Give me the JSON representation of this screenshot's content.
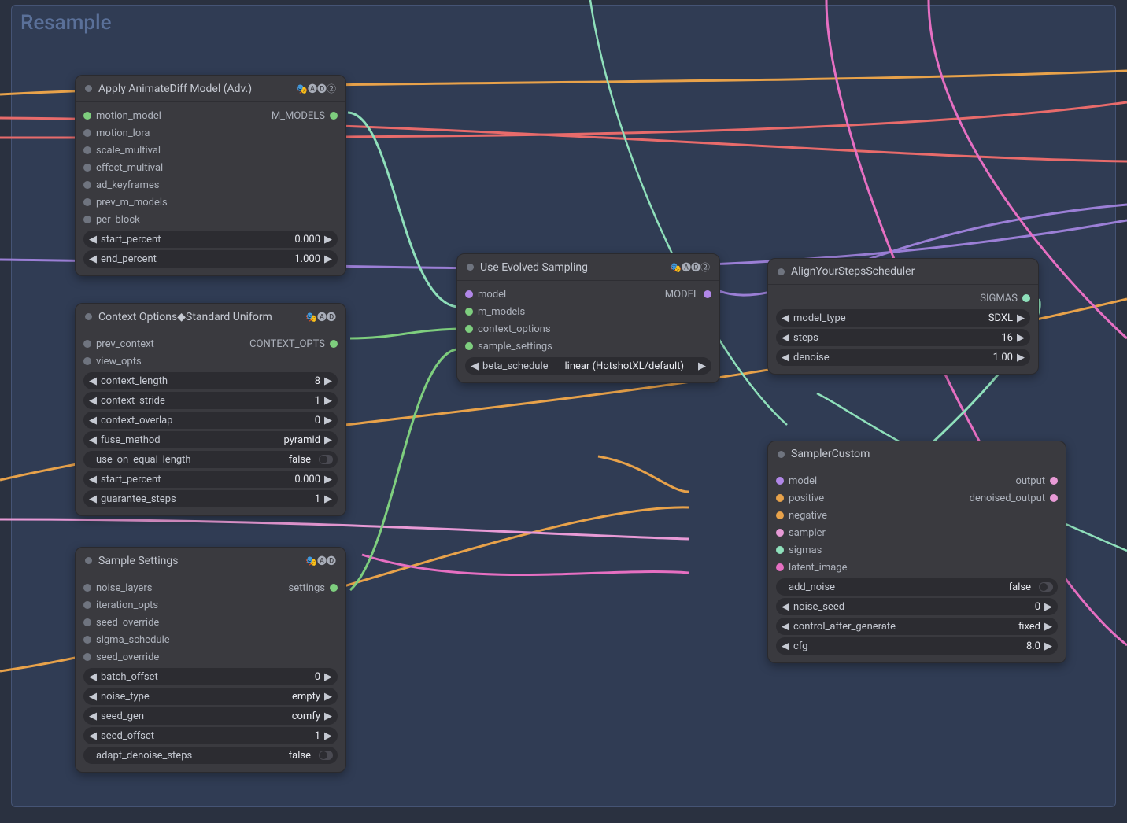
{
  "group": {
    "title": "Resample"
  },
  "nodes": {
    "apply": {
      "title": "Apply AnimateDiff Model (Adv.)",
      "badges": "🎭🅐🅓②",
      "inputs": [
        "motion_model",
        "motion_lora",
        "scale_multival",
        "effect_multival",
        "ad_keyframes",
        "prev_m_models",
        "per_block"
      ],
      "output": "M_MODELS",
      "widgets": [
        {
          "name": "start_percent",
          "value": "0.000"
        },
        {
          "name": "end_percent",
          "value": "1.000"
        }
      ]
    },
    "context": {
      "title": "Context Options◆Standard Uniform",
      "badges": "🎭🅐🅓",
      "inputs": [
        "prev_context",
        "view_opts"
      ],
      "output": "CONTEXT_OPTS",
      "widgets": [
        {
          "name": "context_length",
          "value": "8"
        },
        {
          "name": "context_stride",
          "value": "1"
        },
        {
          "name": "context_overlap",
          "value": "0"
        },
        {
          "name": "fuse_method",
          "value": "pyramid"
        },
        {
          "name": "use_on_equal_length",
          "value": "false",
          "toggle": true
        },
        {
          "name": "start_percent",
          "value": "0.000"
        },
        {
          "name": "guarantee_steps",
          "value": "1"
        }
      ]
    },
    "evolved": {
      "title": "Use Evolved Sampling",
      "badges": "🎭🅐🅓②",
      "inputs": [
        "model",
        "m_models",
        "context_options",
        "sample_settings"
      ],
      "output": "MODEL",
      "widgets": [
        {
          "name": "beta_schedule",
          "value": "linear (HotshotXL/default)"
        }
      ]
    },
    "ays": {
      "title": "AlignYourStepsScheduler",
      "output": "SIGMAS",
      "widgets": [
        {
          "name": "model_type",
          "value": "SDXL"
        },
        {
          "name": "steps",
          "value": "16"
        },
        {
          "name": "denoise",
          "value": "1.00"
        }
      ]
    },
    "sample": {
      "title": "Sample Settings",
      "badges": "🎭🅐🅓",
      "inputs": [
        "noise_layers",
        "iteration_opts",
        "seed_override",
        "sigma_schedule",
        "seed_override"
      ],
      "output": "settings",
      "widgets": [
        {
          "name": "batch_offset",
          "value": "0"
        },
        {
          "name": "noise_type",
          "value": "empty"
        },
        {
          "name": "seed_gen",
          "value": "comfy"
        },
        {
          "name": "seed_offset",
          "value": "1"
        },
        {
          "name": "adapt_denoise_steps",
          "value": "false",
          "toggle": true
        }
      ]
    },
    "sampler": {
      "title": "SamplerCustom",
      "inputs": [
        "model",
        "positive",
        "negative",
        "sampler",
        "sigmas",
        "latent_image"
      ],
      "outputs": [
        "output",
        "denoised_output"
      ],
      "widgets": [
        {
          "name": "add_noise",
          "value": "false",
          "toggle": true
        },
        {
          "name": "noise_seed",
          "value": "0"
        },
        {
          "name": "control_after_generate",
          "value": "fixed"
        },
        {
          "name": "cfg",
          "value": "8.0"
        }
      ]
    }
  }
}
